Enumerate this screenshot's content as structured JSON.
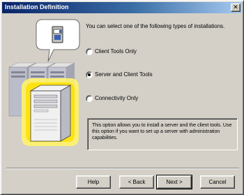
{
  "window": {
    "title": "Installation Definition",
    "close_glyph": "✕"
  },
  "art": {
    "icon": "servers-illustration-icon"
  },
  "main": {
    "intro": "You can select one of the following types of installations.",
    "options": [
      {
        "label": "Client Tools Only",
        "checked": false
      },
      {
        "label": "Server and Client Tools",
        "checked": true
      },
      {
        "label": "Connectivity Only",
        "checked": false
      }
    ],
    "description": "This option allows you to install a server and the client tools. Use this option if you want to set up a server with administration capabilities."
  },
  "buttons": {
    "help": "Help",
    "back": "< Back",
    "next": "Next >",
    "cancel": "Cancel"
  }
}
